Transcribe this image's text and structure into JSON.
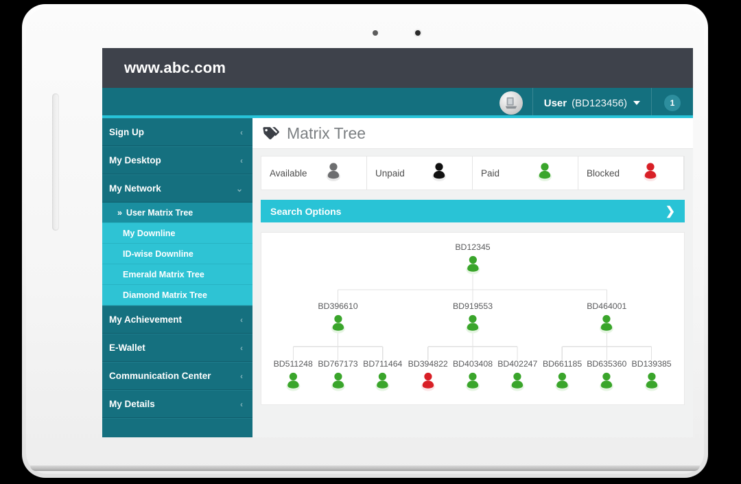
{
  "browser": {
    "url": "www.abc.com"
  },
  "header": {
    "avatar_icon": "user-avatar-icon",
    "user_name": "User",
    "user_id": "(BD123456)",
    "dropdown_icon": "chevron-down-icon",
    "notification_count": "1"
  },
  "sidebar": {
    "items": [
      {
        "label": "Sign Up",
        "icon": "chevron-left-icon",
        "expanded": false
      },
      {
        "label": "My Desktop",
        "icon": "chevron-left-icon",
        "expanded": false
      },
      {
        "label": "My Network",
        "icon": "chevron-down-icon",
        "expanded": true
      },
      {
        "label": "My Achievement",
        "icon": "chevron-left-icon",
        "expanded": false
      },
      {
        "label": "E-Wallet",
        "icon": "chevron-left-icon",
        "expanded": false
      },
      {
        "label": "Communication Center",
        "icon": "chevron-left-icon",
        "expanded": false
      },
      {
        "label": "My Details",
        "icon": "chevron-left-icon",
        "expanded": false
      }
    ],
    "submenu": [
      {
        "label": "User Matrix Tree",
        "active": true,
        "marker": "»"
      },
      {
        "label": "My Downline",
        "active": false
      },
      {
        "label": "ID-wise Downline",
        "active": false
      },
      {
        "label": "Emerald Matrix Tree",
        "active": false
      },
      {
        "label": "Diamond Matrix Tree",
        "active": false
      }
    ]
  },
  "page": {
    "title": "Matrix Tree",
    "title_icon": "tags-icon"
  },
  "legend": [
    {
      "label": "Available",
      "color": "#6d6e70",
      "icon": "person-icon"
    },
    {
      "label": "Unpaid",
      "color": "#111111",
      "icon": "person-icon"
    },
    {
      "label": "Paid",
      "color": "#3aa52b",
      "icon": "person-icon"
    },
    {
      "label": "Blocked",
      "color": "#d81f26",
      "icon": "person-icon"
    }
  ],
  "search": {
    "label": "Search Options",
    "chevron_icon": "chevron-right-icon"
  },
  "tree": {
    "root": {
      "id": "BD12345",
      "status": "paid"
    },
    "level2": [
      {
        "id": "BD396610",
        "status": "paid"
      },
      {
        "id": "BD919553",
        "status": "paid"
      },
      {
        "id": "BD464001",
        "status": "paid"
      }
    ],
    "level3": [
      {
        "id": "BD511248",
        "status": "paid"
      },
      {
        "id": "BD767173",
        "status": "paid"
      },
      {
        "id": "BD711464",
        "status": "paid"
      },
      {
        "id": "BD394822",
        "status": "blocked"
      },
      {
        "id": "BD403408",
        "status": "paid"
      },
      {
        "id": "BD402247",
        "status": "paid"
      },
      {
        "id": "BD661185",
        "status": "paid"
      },
      {
        "id": "BD635360",
        "status": "paid"
      },
      {
        "id": "BD139385",
        "status": "paid"
      }
    ],
    "colors": {
      "paid": "#3aa52b",
      "blocked": "#d81f26",
      "available": "#6d6e70",
      "unpaid": "#111111",
      "connector": "#e0e0e0"
    }
  },
  "theme": {
    "topbar": "#3e424b",
    "teal_dark": "#14707f",
    "teal_accent": "#27c4d9",
    "cyan": "#29c3d6",
    "submenu": "#2ec3d4"
  }
}
